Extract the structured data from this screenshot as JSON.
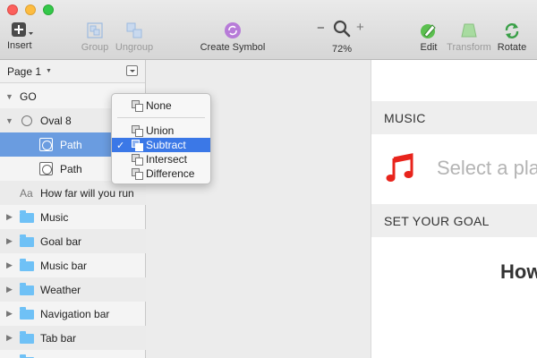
{
  "toolbar": {
    "insert_label": "Insert",
    "group_label": "Group",
    "ungroup_label": "Ungroup",
    "create_symbol_label": "Create Symbol",
    "zoom_minus": "−",
    "zoom_plus": "+",
    "zoom_level": "72%",
    "edit_label": "Edit",
    "transform_label": "Transform",
    "rotate_label": "Rotate"
  },
  "layers": {
    "page_name": "Page 1",
    "rows": [
      {
        "label": "GO",
        "icon": "disclosure-open"
      },
      {
        "label": "Oval 8",
        "icon": "oval-icon"
      },
      {
        "label": "Path",
        "icon": "path-icon",
        "selected": true
      },
      {
        "label": "Path",
        "icon": "path-icon"
      },
      {
        "label": "How far will you run",
        "icon": "text-icon",
        "prefix": "Aa"
      },
      {
        "label": "Music",
        "icon": "folder-icon"
      },
      {
        "label": "Goal bar",
        "icon": "folder-icon"
      },
      {
        "label": "Music bar",
        "icon": "folder-icon"
      },
      {
        "label": "Weather",
        "icon": "folder-icon"
      },
      {
        "label": "Navigation bar",
        "icon": "folder-icon"
      },
      {
        "label": "Tab bar",
        "icon": "folder-icon"
      }
    ]
  },
  "boolean_menu": {
    "items": [
      {
        "label": "None",
        "checked": false
      },
      {
        "label": "Union",
        "checked": false
      },
      {
        "label": "Subtract",
        "checked": true,
        "check_glyph": "✓"
      },
      {
        "label": "Intersect",
        "checked": false
      },
      {
        "label": "Difference",
        "checked": false
      }
    ]
  },
  "artboard": {
    "music_header": "MUSIC",
    "select_text": "Select a pla",
    "goal_header": "SET YOUR GOAL",
    "big_text": "How"
  },
  "colors": {
    "selection": "#6a9ce0",
    "menu_highlight": "#3b78e7",
    "folder": "#6fc1f6",
    "music_note": "#e8241c"
  }
}
